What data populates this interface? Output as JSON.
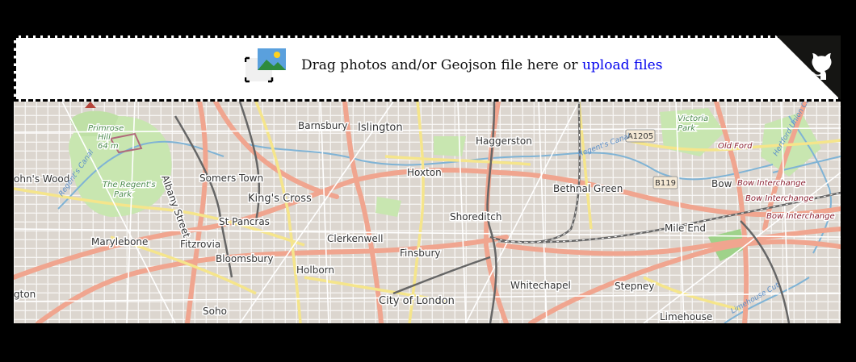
{
  "dropzone": {
    "prompt": "Drag photos and/or Geojson file here or ",
    "link": "upload files"
  },
  "map": {
    "places": [
      {
        "name": "Barnsbury",
        "cls": "lbl-s"
      },
      {
        "name": "Islington",
        "cls": ""
      },
      {
        "name": "Haggerston",
        "cls": "lbl-s"
      },
      {
        "name": "Primrose",
        "cls": "lbl-i"
      },
      {
        "name": "Hill",
        "cls": "lbl-i"
      },
      {
        "name": "64 m",
        "cls": "lbl-i"
      },
      {
        "name": "Victoria",
        "cls": "lbl-i"
      },
      {
        "name": "Park",
        "cls": "lbl-i"
      },
      {
        "name": "Old Ford",
        "cls": "lbl-b"
      },
      {
        "name": "ohn's Wood",
        "cls": "lbl-s"
      },
      {
        "name": "Somers Town",
        "cls": "lbl-s"
      },
      {
        "name": "Hoxton",
        "cls": "lbl-s"
      },
      {
        "name": "The Regent's",
        "cls": "lbl-i"
      },
      {
        "name": "Park",
        "cls": "lbl-i"
      },
      {
        "name": "King's Cross",
        "cls": ""
      },
      {
        "name": "Bethnal Green",
        "cls": "lbl-s"
      },
      {
        "name": "Bow",
        "cls": "lbl-s"
      },
      {
        "name": "Bow Interchange",
        "cls": "lbl-b"
      },
      {
        "name": "Bow Interchange",
        "cls": "lbl-b"
      },
      {
        "name": "Bow Interchange",
        "cls": "lbl-b"
      },
      {
        "name": "St Pancras",
        "cls": "lbl-s"
      },
      {
        "name": "Shoreditch",
        "cls": "lbl-s"
      },
      {
        "name": "Mile End",
        "cls": "lbl-s"
      },
      {
        "name": "Marylebone",
        "cls": "lbl-s"
      },
      {
        "name": "Fitzrovia",
        "cls": "lbl-s"
      },
      {
        "name": "Clerkenwell",
        "cls": "lbl-s"
      },
      {
        "name": "Finsbury",
        "cls": "lbl-s"
      },
      {
        "name": "Bloomsbury",
        "cls": "lbl-s"
      },
      {
        "name": "Holborn",
        "cls": "lbl-s"
      },
      {
        "name": "Whitechapel",
        "cls": "lbl-s"
      },
      {
        "name": "Stepney",
        "cls": "lbl-s"
      },
      {
        "name": "City of London",
        "cls": ""
      },
      {
        "name": "gton",
        "cls": "lbl-s"
      },
      {
        "name": "Soho",
        "cls": "lbl-s"
      },
      {
        "name": "Limehouse",
        "cls": "lbl-s"
      },
      {
        "name": "Albany Street",
        "cls": "lbl-s"
      }
    ],
    "shields": [
      "A1205",
      "B119"
    ],
    "water_labels": [
      "Regent's Canal",
      "Regent's Canal",
      "Hertford Union Canal",
      "Limehouse Cut"
    ]
  },
  "colors": {
    "main_road": "#f0a58f",
    "secondary_road": "#f7fabf",
    "park": "#c8e6b0",
    "water": "#aad3df",
    "rail": "#777777",
    "link": "#0000ee"
  }
}
